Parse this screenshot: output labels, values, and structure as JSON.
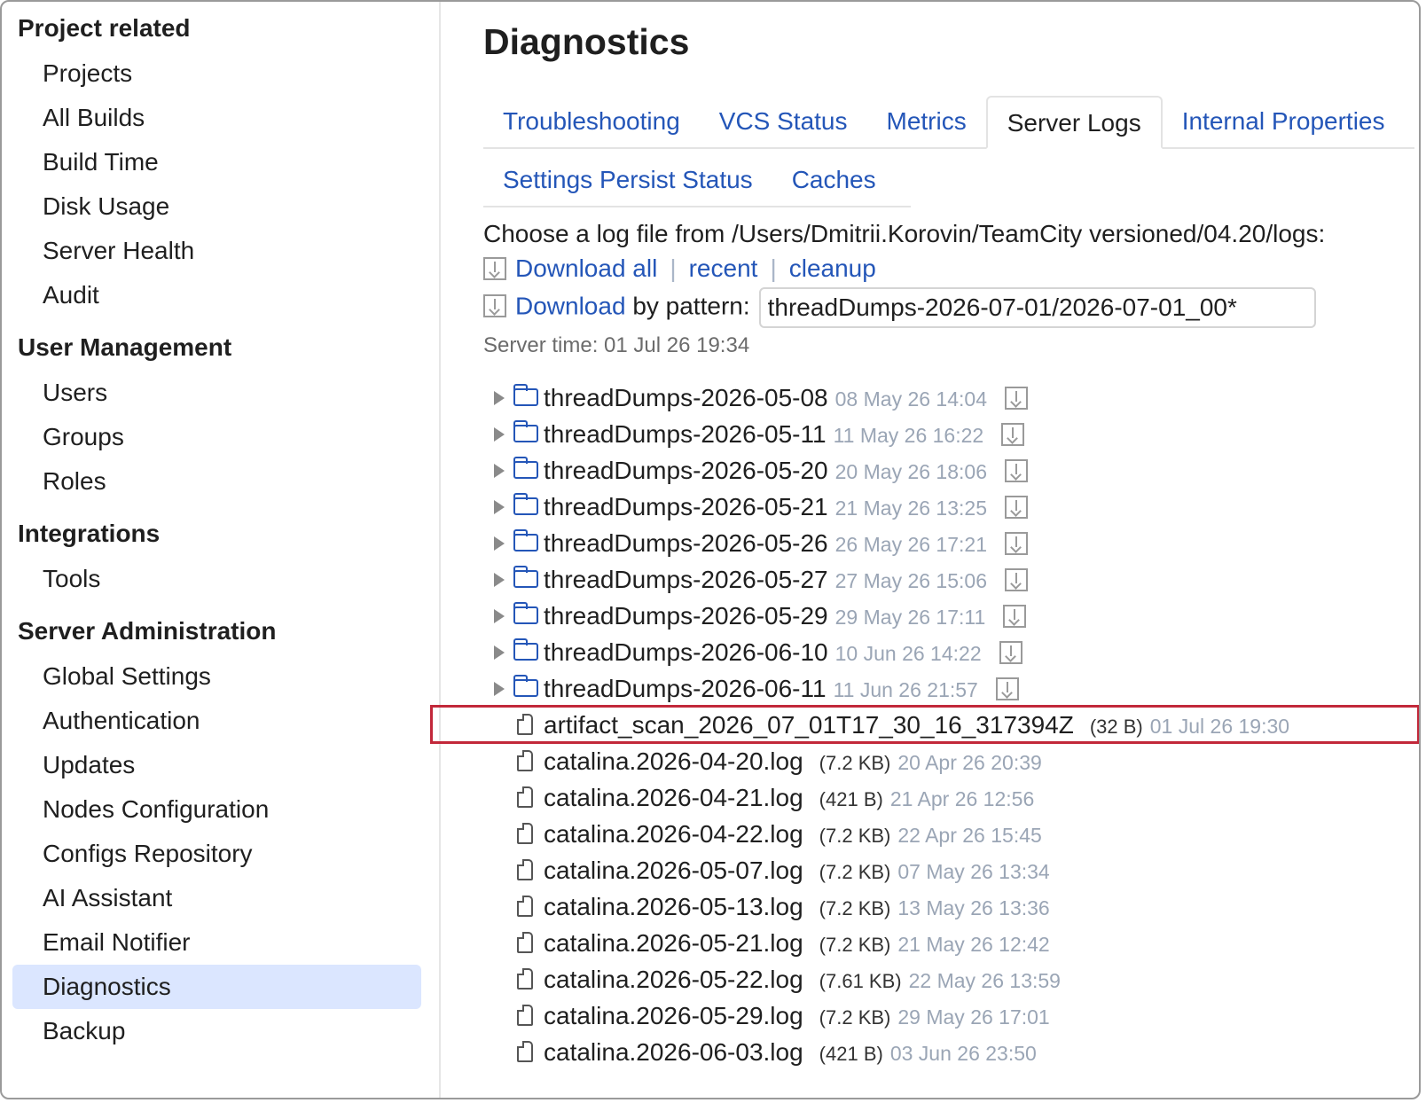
{
  "sidebar": {
    "sections": [
      {
        "title": "Project related",
        "items": [
          "Projects",
          "All Builds",
          "Build Time",
          "Disk Usage",
          "Server Health",
          "Audit"
        ]
      },
      {
        "title": "User Management",
        "items": [
          "Users",
          "Groups",
          "Roles"
        ]
      },
      {
        "title": "Integrations",
        "items": [
          "Tools"
        ]
      },
      {
        "title": "Server Administration",
        "items": [
          "Global Settings",
          "Authentication",
          "Updates",
          "Nodes Configuration",
          "Configs Repository",
          "AI Assistant",
          "Email Notifier",
          "Diagnostics",
          "Backup"
        ]
      }
    ],
    "active_item": "Diagnostics"
  },
  "main": {
    "title": "Diagnostics",
    "tabs_row1": [
      "Troubleshooting",
      "VCS Status",
      "Metrics",
      "Server Logs",
      "Internal Properties"
    ],
    "tabs_row2": [
      "Settings Persist Status",
      "Caches"
    ],
    "active_tab": "Server Logs",
    "choose_text": "Choose a log file from /Users/Dmitrii.Korovin/TeamCity versioned/04.20/logs:",
    "download_all": "Download all",
    "recent": "recent",
    "cleanup": "cleanup",
    "separator": "|",
    "download": "Download",
    "by_pattern": "by pattern:",
    "pattern_value": "threadDumps-2026-07-01/2026-07-01_00*",
    "server_time": "Server time: 01 Jul 26 19:34"
  },
  "folders": [
    {
      "name": "threadDumps-2026-05-08",
      "date": "08 May 26 14:04"
    },
    {
      "name": "threadDumps-2026-05-11",
      "date": "11 May 26 16:22"
    },
    {
      "name": "threadDumps-2026-05-20",
      "date": "20 May 26 18:06"
    },
    {
      "name": "threadDumps-2026-05-21",
      "date": "21 May 26 13:25"
    },
    {
      "name": "threadDumps-2026-05-26",
      "date": "26 May 26 17:21"
    },
    {
      "name": "threadDumps-2026-05-27",
      "date": "27 May 26 15:06"
    },
    {
      "name": "threadDumps-2026-05-29",
      "date": "29 May 26 17:11"
    },
    {
      "name": "threadDumps-2026-06-10",
      "date": "10 Jun 26 14:22"
    },
    {
      "name": "threadDumps-2026-06-11",
      "date": "11 Jun 26 21:57"
    }
  ],
  "files": [
    {
      "name": "artifact_scan_2026_07_01T17_30_16_317394Z",
      "size": "(32 B)",
      "date": "01 Jul 26 19:30",
      "highlighted": true
    },
    {
      "name": "catalina.2026-04-20.log",
      "size": "(7.2 KB)",
      "date": "20 Apr 26 20:39"
    },
    {
      "name": "catalina.2026-04-21.log",
      "size": "(421 B)",
      "date": "21 Apr 26 12:56"
    },
    {
      "name": "catalina.2026-04-22.log",
      "size": "(7.2 KB)",
      "date": "22 Apr 26 15:45"
    },
    {
      "name": "catalina.2026-05-07.log",
      "size": "(7.2 KB)",
      "date": "07 May 26 13:34"
    },
    {
      "name": "catalina.2026-05-13.log",
      "size": "(7.2 KB)",
      "date": "13 May 26 13:36"
    },
    {
      "name": "catalina.2026-05-21.log",
      "size": "(7.2 KB)",
      "date": "21 May 26 12:42"
    },
    {
      "name": "catalina.2026-05-22.log",
      "size": "(7.61 KB)",
      "date": "22 May 26 13:59"
    },
    {
      "name": "catalina.2026-05-29.log",
      "size": "(7.2 KB)",
      "date": "29 May 26 17:01"
    },
    {
      "name": "catalina.2026-06-03.log",
      "size": "(421 B)",
      "date": "03 Jun 26 23:50"
    }
  ],
  "colors": {
    "link": "#2456b8",
    "highlight_border": "#c2283a",
    "active_nav_bg": "#dbe6ff"
  }
}
